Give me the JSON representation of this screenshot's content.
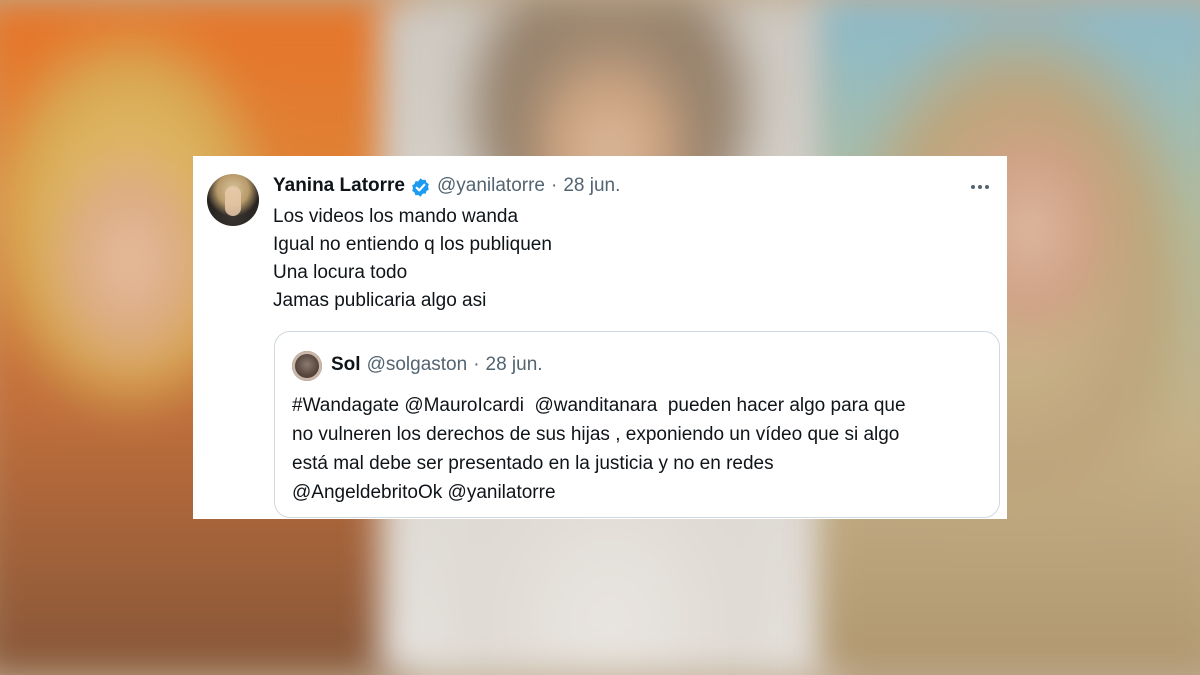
{
  "tweet": {
    "author_name": "Yanina Latorre",
    "handle": "@yanilatorre",
    "separator": "·",
    "date": "28 jun.",
    "verified_icon": "verified-badge-icon",
    "more_icon": "more-options-icon",
    "lines": [
      "Los videos los mando wanda",
      "Igual no entiendo q los publiquen",
      "Una locura todo",
      "Jamas publicaria algo asi"
    ]
  },
  "quoted_tweet": {
    "author_name": "Sol",
    "handle": "@solgaston",
    "separator": "·",
    "date": "28 jun.",
    "lines": [
      "#Wandagate @MauroIcardi  @wanditanara  pueden hacer algo para que",
      "no vulneren los derechos de sus hijas , exponiendo un vídeo que si algo",
      "está mal debe ser presentado en la justicia y no en redes",
      "@AngeldebritoOk @yanilatorre"
    ]
  },
  "colors": {
    "verified_blue": "#1d9bf0",
    "text_primary": "#0f1419",
    "text_secondary": "#536471",
    "quote_border": "#cfd9de"
  }
}
